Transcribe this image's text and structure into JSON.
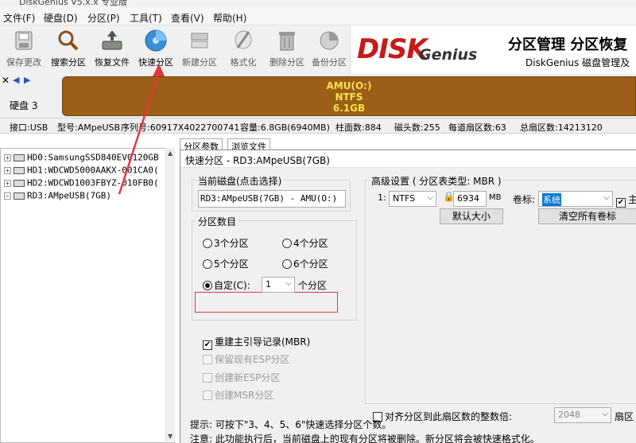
{
  "window": {
    "title": "DiskGenius V5.x.x 专业版"
  },
  "menu": [
    "文件(F)",
    "硬盘(D)",
    "分区(P)",
    "工具(T)",
    "查看(V)",
    "帮助(H)"
  ],
  "toolbar": [
    {
      "label": "保存更改",
      "icon": "save-disk-icon"
    },
    {
      "label": "搜索分区",
      "icon": "magnifier-icon"
    },
    {
      "label": "恢复文件",
      "icon": "recover-drive-icon"
    },
    {
      "label": "快速分区",
      "icon": "quick-partition-icon"
    },
    {
      "label": "新建分区",
      "icon": "new-partition-icon"
    },
    {
      "label": "格式化",
      "icon": "format-icon"
    },
    {
      "label": "删除分区",
      "icon": "trash-icon"
    },
    {
      "label": "备份分区",
      "icon": "backup-icon"
    }
  ],
  "banner": {
    "logo_main": "DISK",
    "logo_sub": "Genius",
    "slogan1": "分区管理 分区恢复",
    "slogan2": "DiskGenius 磁盘管理及"
  },
  "disk": {
    "label": "硬盘 3",
    "partition": {
      "name": "AMU(O:)",
      "fs": "NTFS",
      "size": "6.1GB"
    },
    "info": {
      "interface": "接口:USB",
      "model": "型号:AMpeUSB",
      "serial": "序列号:60917X4022700741",
      "capacity": "容量:6.8GB(6940MB)",
      "cylinders": "柱面数:884",
      "heads": "磁头数:255",
      "sectors_per_track": "每道扇区数:63",
      "total_sectors": "总扇区数:14213120"
    }
  },
  "tree": [
    {
      "label": "HD0:SamsungSSD840EV0120GB"
    },
    {
      "label": "HD1:WDCWD5000AAKX-001CA0("
    },
    {
      "label": "HD2:WDCWD1003FBYZ-010FB0("
    },
    {
      "label": "RD3:AMpeUSB(7GB)"
    }
  ],
  "tabs": [
    "分区参数",
    "浏览文件"
  ],
  "dialog": {
    "title": "快速分区 - RD3:AMpeUSB(7GB)",
    "current_disk_group": "当前磁盘(点击选择)",
    "current_disk_value": "RD3:AMpeUSB(7GB) - AMU(O:)",
    "partition_count_group": "分区数目",
    "radios": [
      "3个分区",
      "4个分区",
      "5个分区",
      "6个分区"
    ],
    "custom_label": "自定(C):",
    "custom_value": "1",
    "custom_suffix": "个分区",
    "rebuild_mbr": "重建主引导记录(MBR)",
    "keep_esp": "保留现有ESP分区",
    "create_esp": "创建新ESP分区",
    "create_msr": "创建MSR分区",
    "advanced_group": "高级设置 ( 分区表类型: MBR )",
    "row_index": "1:",
    "fs_value": "NTFS",
    "size_value": "6934",
    "size_unit": "MB",
    "volume_label_text": "卷标:",
    "volume_label_value": "系统",
    "primary_label": "主",
    "default_size_btn": "默认大小",
    "clear_labels_btn": "清空所有卷标",
    "align_label": "对齐分区到此扇区数的整数倍:",
    "align_value": "2048",
    "align_unit": "扇区",
    "hint1": "提示: 可按下\"3、4、5、6\"快速选择分区个数。",
    "hint2": "注意: 此功能执行后，当前磁盘上的现有分区将被删除。新分区将会被快速格式化。"
  },
  "colors": {
    "partition_fill": "#9b5f1a",
    "partition_text": "#ffe24a",
    "logo_red": "#c71a1a",
    "highlight": "#e0393e",
    "selection": "#0078d7"
  }
}
